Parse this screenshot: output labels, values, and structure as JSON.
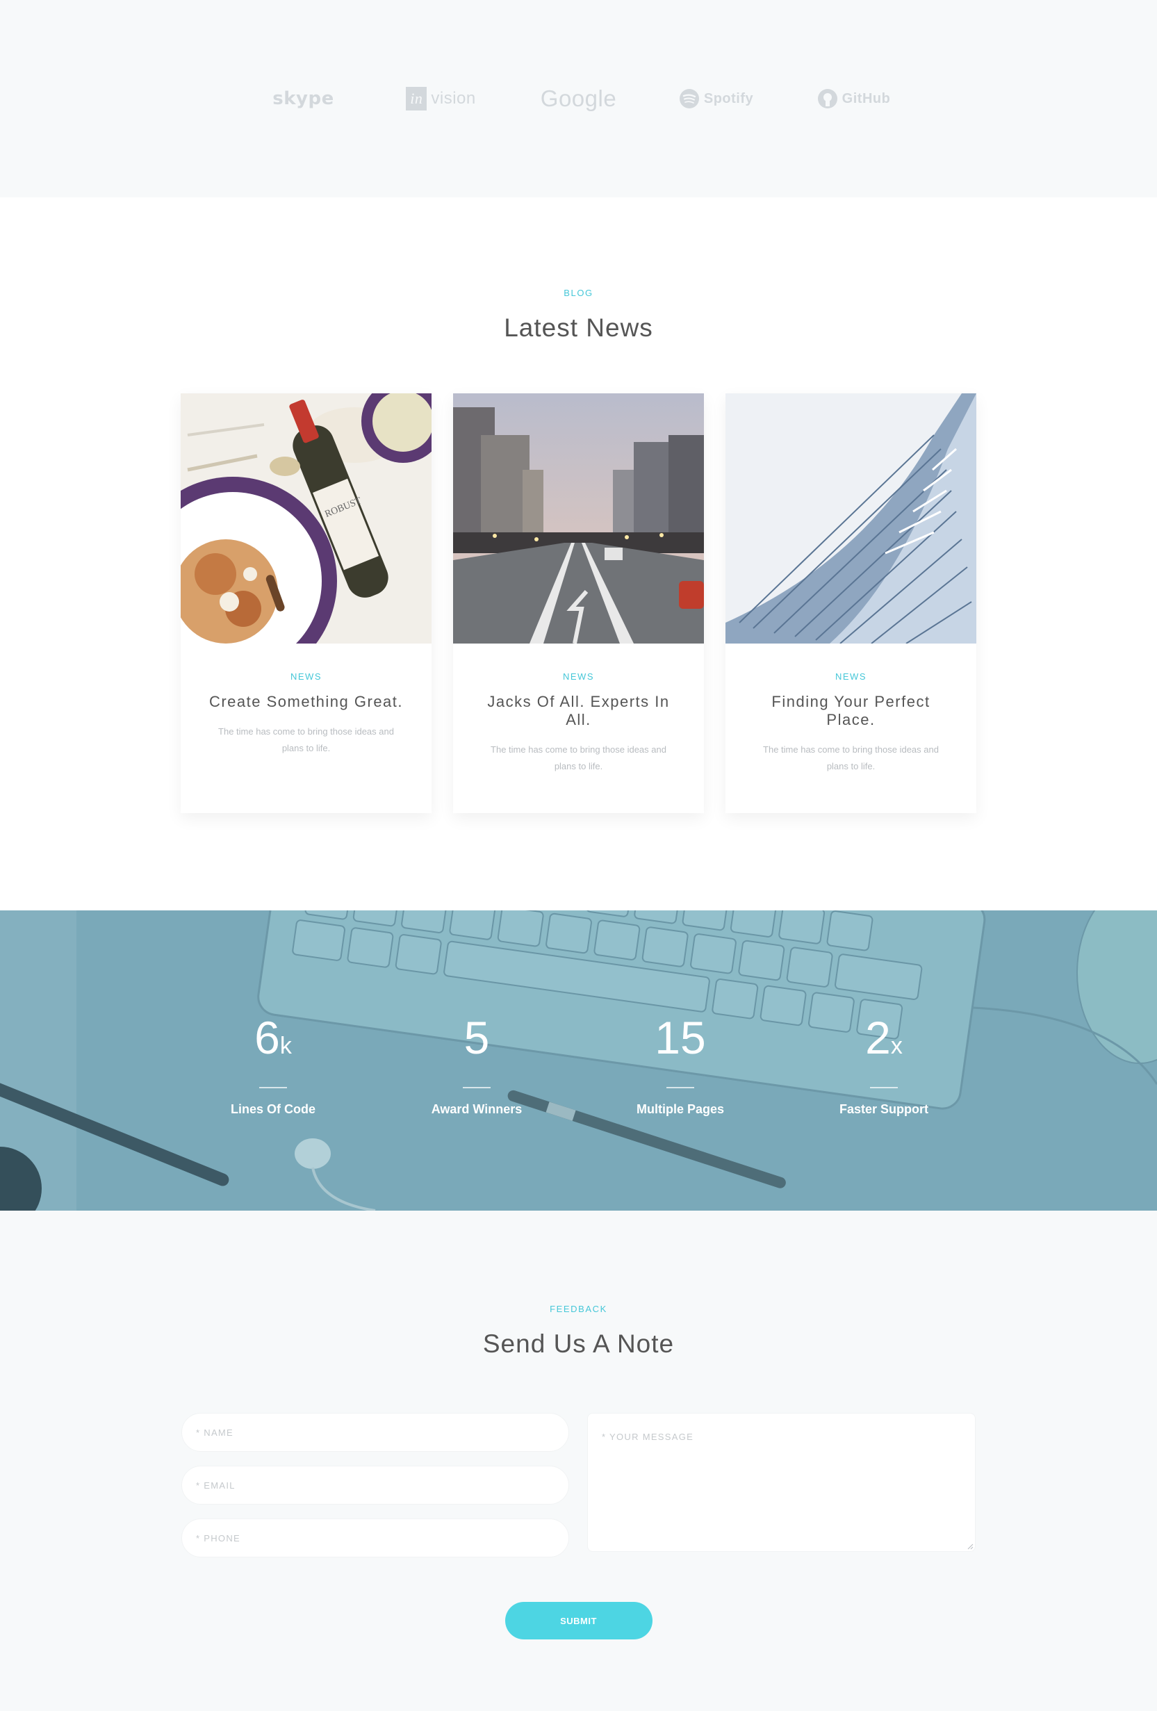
{
  "logos": [
    "skype",
    "in",
    "vision",
    "Google",
    "Spotify",
    "GitHub"
  ],
  "blog": {
    "eyebrow": "BLOG",
    "title": "Latest News",
    "posts": [
      {
        "category": "NEWS",
        "title": "Create Something Great.",
        "text": "The time has come to bring those ideas and plans to life."
      },
      {
        "category": "NEWS",
        "title": "Jacks Of All. Experts In All.",
        "text": "The time has come to bring those ideas and plans to life."
      },
      {
        "category": "NEWS",
        "title": "Finding Your Perfect Place.",
        "text": "The time has come to bring those ideas and plans to life."
      }
    ]
  },
  "stats": [
    {
      "value": "6",
      "suffix": "k",
      "label": "Lines Of Code"
    },
    {
      "value": "5",
      "suffix": "",
      "label": "Award Winners"
    },
    {
      "value": "15",
      "suffix": "",
      "label": "Multiple Pages"
    },
    {
      "value": "2",
      "suffix": "x",
      "label": "Faster Support"
    }
  ],
  "feedback": {
    "eyebrow": "FEEDBACK",
    "title": "Send Us A Note",
    "name_placeholder": "* NAME",
    "email_placeholder": "* EMAIL",
    "phone_placeholder": "* PHONE",
    "message_placeholder": "* YOUR MESSAGE",
    "submit_label": "SUBMIT"
  },
  "colors": {
    "accent": "#45c7d8",
    "button": "#4dd5e3",
    "stats_overlay": "#78a8b8"
  }
}
